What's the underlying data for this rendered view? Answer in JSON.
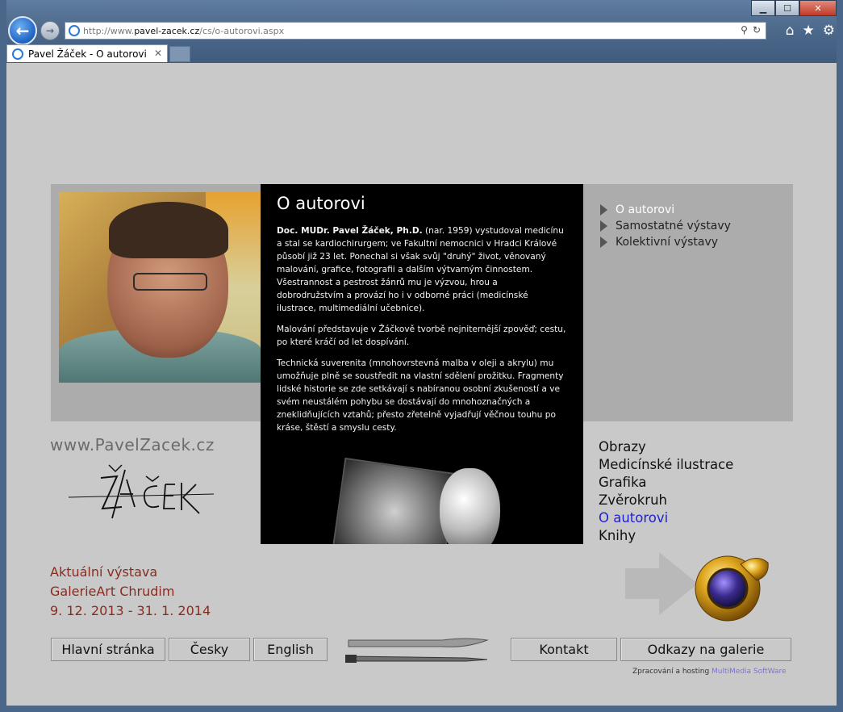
{
  "browser": {
    "url_prefix": "http://www.",
    "url_domain": "pavel-zacek.cz",
    "url_path": "/cs/o-autorovi.aspx",
    "tab_title": "Pavel Žáček - O autorovi",
    "tab_close": "✕",
    "window_controls": {
      "minimize": "▁",
      "maximize": "☐",
      "close": "✕"
    },
    "back_icon": "←",
    "forward_icon": "→",
    "search_icon": "⚲",
    "refresh_icon": "↻",
    "home_icon": "⌂",
    "favorites_icon": "★",
    "settings_icon": "⚙"
  },
  "article": {
    "title": "O autorovi",
    "p1_bold": "Doc. MUDr. Pavel Žáček, Ph.D.",
    "p1_rest": " (nar. 1959) vystudoval medicínu a stal se kardiochirurgem; ve Fakultní nemocnici v Hradci Králové působí již 23 let. Ponechal si však svůj \"druhý\" život, věnovaný malování, grafice, fotografii a dalším výtvarným činnostem. Všestrannost a pestrost žánrů mu je výzvou, hrou a dobrodružstvím a provází ho i v odborné práci (medicínské ilustrace, multimediální učebnice).",
    "p2": "Malování představuje v Žáčkově tvorbě nejniternější zpověď; cestu, po které kráčí od let dospívání.",
    "p3": "Technická suverenita (mnohovrstevná malba v oleji a akrylu) mu umožňuje plně se soustředit na vlastní sdělení prožitku. Fragmenty lidské historie se zde setkávají s nabíranou osobní zkušeností a ve svém neustálém pohybu se dostávají do mnohoznačných a zneklidňujících vztahů; přesto zřetelně vyjadřují věčnou touhu po kráse, štěstí a smyslu cesty."
  },
  "submenu": [
    "O autorovi",
    "Samostatné výstavy",
    "Kolektivní výstavy"
  ],
  "site_url": "www.PavelZacek.cz",
  "signature_text": "ŽÁČEK",
  "exhibition": {
    "line1": "Aktuální výstava",
    "line2": "GalerieArt Chrudim",
    "line3": "9. 12. 2013 - 31. 1. 2014"
  },
  "mainmenu": [
    "Obrazy",
    "Medicínské ilustrace",
    "Grafika",
    "Zvěrokruh",
    "O autorovi",
    "Knihy"
  ],
  "bottom_nav": {
    "home": "Hlavní stránka",
    "czech": "Česky",
    "english": "English",
    "contact": "Kontakt",
    "links": "Odkazy na galerie"
  },
  "credit": {
    "text": "Zpracování a hosting ",
    "link": "MultiMedia SoftWare"
  },
  "colors": {
    "page_bg": "#c9c9c9",
    "band": "#acacac",
    "exhibition_text": "#8b2b1f",
    "current_menu": "#1f1fd6"
  }
}
